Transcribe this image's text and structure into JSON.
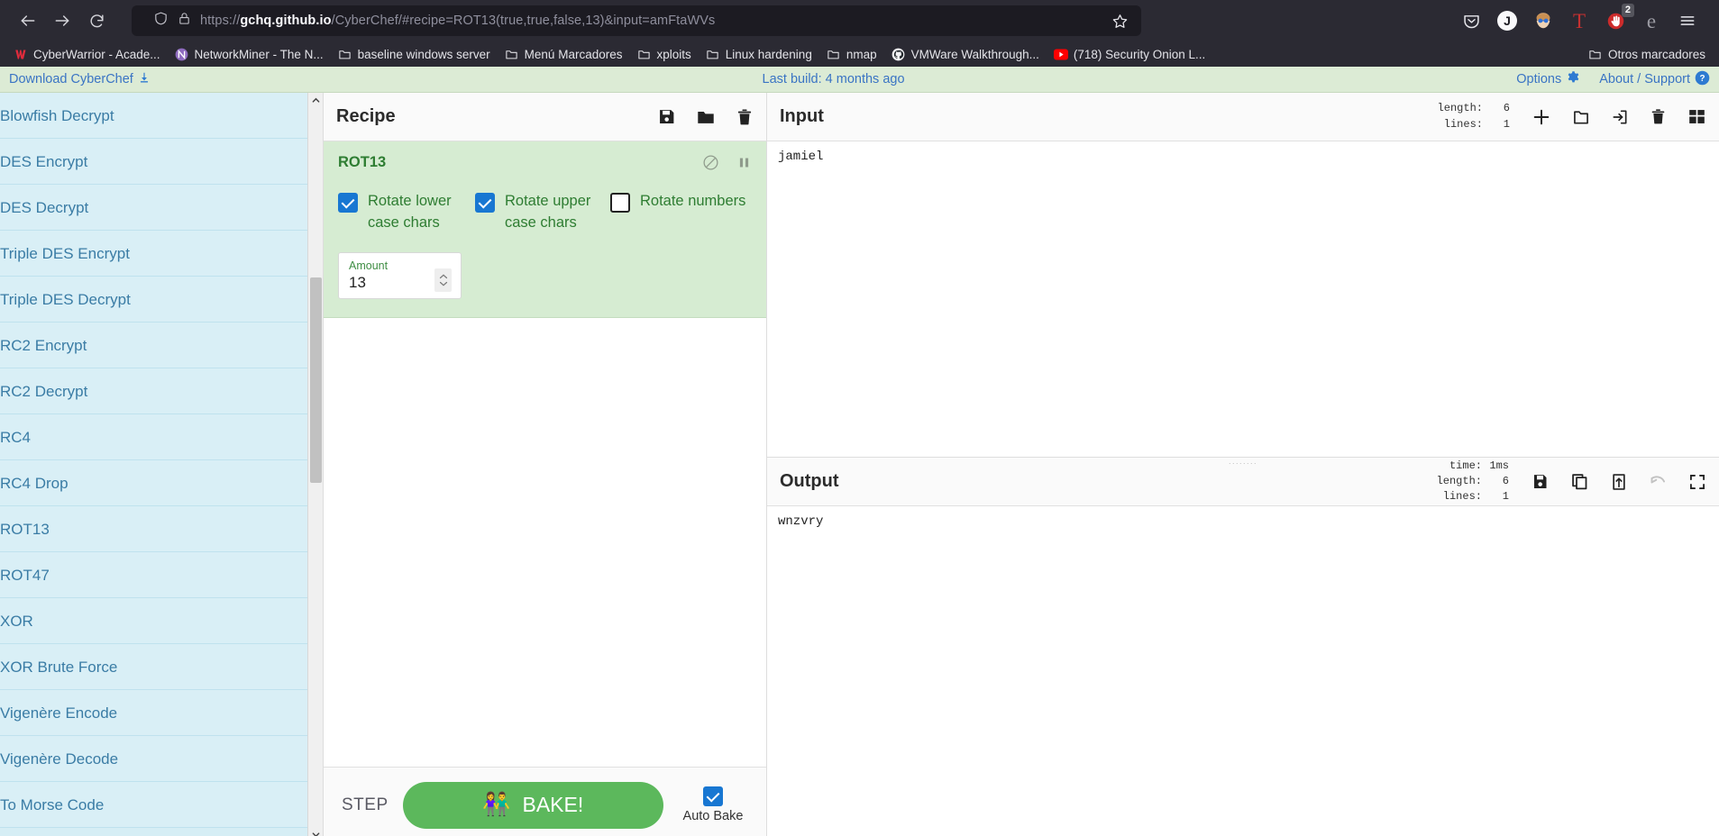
{
  "browser": {
    "nav": {
      "back": "back-arrow",
      "forward": "forward-arrow",
      "reload": "reload"
    },
    "url": {
      "prefix": "https://",
      "host": "gchq.github.io",
      "path": "/CyberChef/#recipe=ROT13(true,true,false,13)&input=amFtaWVs",
      "full": "https://gchq.github.io/CyberChef/#recipe=ROT13(true,true,false,13)&input=amFtaWVs"
    },
    "toolbar_icons": [
      {
        "name": "pocket-icon",
        "glyph": "pocket"
      },
      {
        "name": "jdownloader-icon",
        "glyph": "J"
      },
      {
        "name": "account-avatar-icon",
        "glyph": "avatar"
      },
      {
        "name": "tampermonkey-icon",
        "glyph": "T"
      },
      {
        "name": "ublock-origin-icon",
        "glyph": "hand",
        "badge": "2"
      },
      {
        "name": "edge-extension-icon",
        "glyph": "e"
      },
      {
        "name": "app-menu-icon",
        "glyph": "hamburger"
      }
    ],
    "bookmarks": [
      {
        "label": "CyberWarrior - Acade...",
        "icon": "cyberwarrior-favicon"
      },
      {
        "label": "NetworkMiner - The N...",
        "icon": "networkminer-favicon"
      },
      {
        "label": "baseline windows server",
        "icon": "folder-icon"
      },
      {
        "label": "Menú Marcadores",
        "icon": "folder-icon"
      },
      {
        "label": "xploits",
        "icon": "folder-icon"
      },
      {
        "label": "Linux hardening",
        "icon": "folder-icon"
      },
      {
        "label": "nmap",
        "icon": "folder-icon"
      },
      {
        "label": "VMWare Walkthrough...",
        "icon": "github-favicon"
      },
      {
        "label": "(718) Security Onion L...",
        "icon": "youtube-favicon"
      }
    ],
    "other_bookmarks": {
      "label": "Otros marcadores",
      "icon": "folder-icon"
    }
  },
  "cyberchef": {
    "banner": {
      "download_label": "Download CyberChef",
      "build_label": "Last build: 4 months ago",
      "options_label": "Options",
      "about_label": "About / Support"
    },
    "operations": [
      "Blowfish Decrypt",
      "DES Encrypt",
      "DES Decrypt",
      "Triple DES Encrypt",
      "Triple DES Decrypt",
      "RC2 Encrypt",
      "RC2 Decrypt",
      "RC4",
      "RC4 Drop",
      "ROT13",
      "ROT47",
      "XOR",
      "XOR Brute Force",
      "Vigenère Encode",
      "Vigenère Decode",
      "To Morse Code"
    ],
    "recipe": {
      "title": "Recipe",
      "icons": [
        {
          "name": "save-recipe-icon"
        },
        {
          "name": "load-recipe-icon"
        },
        {
          "name": "clear-recipe-icon"
        }
      ],
      "operation": {
        "name": "ROT13",
        "head_icons": [
          {
            "name": "disable-operation-icon"
          },
          {
            "name": "set-breakpoint-icon"
          }
        ],
        "args": [
          {
            "label": "Rotate lower case chars",
            "checked": true
          },
          {
            "label": "Rotate upper case chars",
            "checked": true
          },
          {
            "label": "Rotate numbers",
            "checked": false
          }
        ],
        "amount": {
          "label": "Amount",
          "value": "13"
        }
      }
    },
    "bake": {
      "step_label": "STEP",
      "bake_label": "BAKE!",
      "auto_bake_label": "Auto Bake",
      "auto_bake_checked": true
    },
    "input": {
      "title": "Input",
      "value": "jamiel",
      "stats": [
        {
          "key": "length:",
          "value": "6"
        },
        {
          "key": "lines:",
          "value": "1"
        }
      ],
      "icons": [
        {
          "name": "add-input-tab-icon"
        },
        {
          "name": "open-folder-as-input-icon"
        },
        {
          "name": "open-file-as-input-icon"
        },
        {
          "name": "clear-input-icon"
        },
        {
          "name": "reset-pane-layout-icon"
        }
      ]
    },
    "output": {
      "title": "Output",
      "value": "wnzvry",
      "stats": [
        {
          "key": "time:",
          "value": "1ms"
        },
        {
          "key": "length:",
          "value": "6"
        },
        {
          "key": "lines:",
          "value": "1"
        }
      ],
      "icons": [
        {
          "name": "save-output-icon"
        },
        {
          "name": "copy-output-icon"
        },
        {
          "name": "replace-input-with-output-icon"
        },
        {
          "name": "undo-bake-icon"
        },
        {
          "name": "maximise-output-icon"
        }
      ]
    }
  },
  "colors": {
    "chrome_bg": "#2b2a33",
    "url_bg": "#1c1b22",
    "banner_bg": "#dcebd5",
    "link_blue": "#3a74c4",
    "ops_bg": "#d9eff6",
    "ops_text": "#3a7ca5",
    "recipe_op_bg": "#d6ecd2",
    "op_green": "#2e7d32",
    "checkbox_blue": "#1877d2",
    "bake_green": "#5cb85c"
  }
}
